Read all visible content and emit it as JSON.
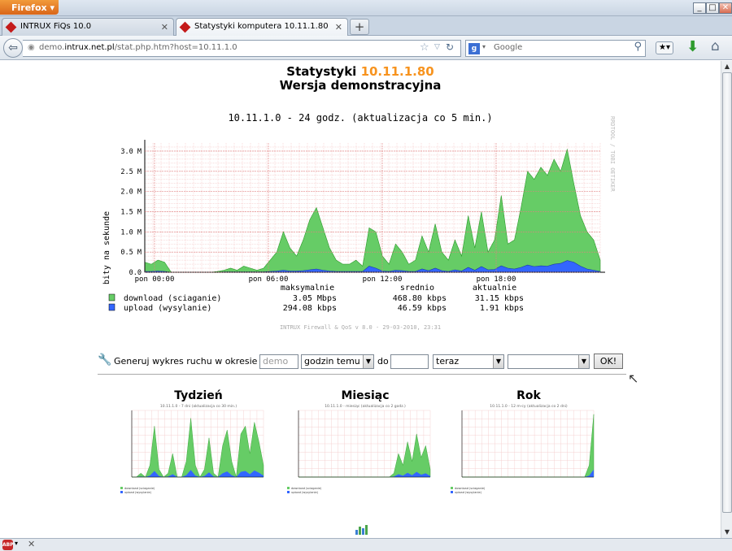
{
  "browser": {
    "menu_button": "Firefox",
    "tabs": [
      {
        "label": "INTRUX FiQs 10.0"
      },
      {
        "label": "Statystyki komputera 10.11.1.80"
      }
    ],
    "url_prefix": "demo.",
    "url_domain": "intrux.net.pl",
    "url_path": "/stat.php.htm?host=10.11.1.0",
    "search_engine": "Google"
  },
  "page": {
    "title_prefix": "Statystyki",
    "title_host": "10.11.1.80",
    "subtitle": "Wersja demonstracyjna",
    "accent_color": "#f7931e"
  },
  "chart_data": {
    "type": "area",
    "title": "10.11.1.0 - 24 godz. (aktualizacja co 5 min.)",
    "ylabel": "bity na sekunde",
    "side_label": "RRDTOOL / TOBI OETIKER",
    "yticks": [
      "0.0",
      "0.5 M",
      "1.0 M",
      "1.5 M",
      "2.0 M",
      "2.5 M",
      "3.0 M"
    ],
    "ylim": [
      0,
      3.2
    ],
    "xticks": [
      "pon 00:00",
      "pon 06:00",
      "pon 12:00",
      "pon 18:00"
    ],
    "footer": "INTRUX Firewall & QoS v 8.0 - 29-03-2010, 23:31",
    "stats_headers": [
      "maksymalnie",
      "srednio",
      "aktualnie"
    ],
    "series": [
      {
        "name": "download (sciaganie)",
        "color": "#66cc66",
        "max": "3.05 Mbps",
        "avg": "468.80 kbps",
        "cur": "31.15 kbps",
        "values": [
          0.25,
          0.2,
          0.3,
          0.25,
          0.0,
          0.0,
          0.0,
          0.0,
          0.0,
          0.0,
          0.0,
          0.02,
          0.05,
          0.1,
          0.05,
          0.15,
          0.1,
          0.05,
          0.1,
          0.3,
          0.5,
          1.0,
          0.6,
          0.4,
          0.8,
          1.3,
          1.6,
          1.1,
          0.6,
          0.3,
          0.2,
          0.2,
          0.3,
          0.15,
          1.1,
          1.0,
          0.4,
          0.2,
          0.7,
          0.5,
          0.2,
          0.3,
          0.9,
          0.5,
          1.2,
          0.5,
          0.3,
          0.8,
          0.4,
          1.4,
          0.6,
          1.5,
          0.5,
          0.8,
          1.9,
          0.7,
          0.8,
          1.6,
          2.5,
          2.3,
          2.6,
          2.4,
          2.8,
          2.5,
          3.05,
          2.2,
          1.4,
          1.0,
          0.8,
          0.3
        ]
      },
      {
        "name": "upload (wysylanie)",
        "color": "#3366ff",
        "max": "294.08 kbps",
        "avg": "46.59 kbps",
        "cur": "1.91 kbps",
        "values": [
          0.02,
          0.02,
          0.03,
          0.02,
          0.0,
          0.0,
          0.0,
          0.0,
          0.0,
          0.0,
          0.0,
          0.0,
          0.01,
          0.01,
          0.01,
          0.01,
          0.01,
          0.01,
          0.01,
          0.02,
          0.03,
          0.05,
          0.03,
          0.03,
          0.04,
          0.06,
          0.08,
          0.05,
          0.03,
          0.02,
          0.02,
          0.02,
          0.02,
          0.02,
          0.15,
          0.1,
          0.03,
          0.02,
          0.05,
          0.04,
          0.02,
          0.02,
          0.08,
          0.04,
          0.1,
          0.04,
          0.02,
          0.06,
          0.03,
          0.12,
          0.05,
          0.14,
          0.06,
          0.07,
          0.16,
          0.1,
          0.08,
          0.12,
          0.18,
          0.14,
          0.16,
          0.15,
          0.2,
          0.22,
          0.29,
          0.25,
          0.15,
          0.08,
          0.05,
          0.02
        ]
      }
    ]
  },
  "generator": {
    "label": "Generuj wykres ruchu w okresie od",
    "from_placeholder": "demo",
    "unit_select": "godzin temu",
    "to_label": "do",
    "to_value": "",
    "end_select": "teraz",
    "extra_select": "",
    "ok_label": "OK!"
  },
  "thumbnails": [
    {
      "title": "Tydzień",
      "caption": "10.11.1.0 - 7 dni (aktualizacja co 30 min.)"
    },
    {
      "title": "Miesiąc",
      "caption": "10.11.1.0 - miesiąc (aktualizacja co 2 godz.)"
    },
    {
      "title": "Rok",
      "caption": "10.11.1.0 - 12 m-cy (aktualizacja co 2 dni)"
    }
  ]
}
